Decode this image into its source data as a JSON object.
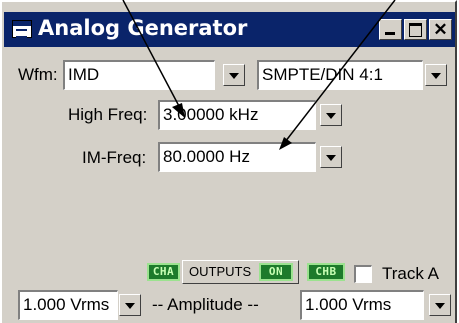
{
  "window": {
    "title": "Analog Generator"
  },
  "waveform": {
    "label": "Wfm:",
    "type_value": "IMD",
    "mode_value": "SMPTE/DIN 4:1"
  },
  "high_freq": {
    "label": "High Freq:",
    "value": "3.00000 kHz"
  },
  "im_freq": {
    "label": "IM-Freq:",
    "value": "80.0000  Hz"
  },
  "outputs": {
    "cha_badge": "CHA",
    "chb_badge": "CHB",
    "outputs_label": "OUTPUTS",
    "on_badge": "ON",
    "track_label": "Track A"
  },
  "amplitude": {
    "label": "-- Amplitude --",
    "left_value": "1.000   Vrms",
    "right_value": "1.000   Vrms"
  },
  "colors": {
    "titlebar": "#0a246a",
    "panel": "#d4d0c8",
    "badge": "#1d7a2b"
  },
  "icons": [
    "window-icon",
    "minimize-icon",
    "maximize-icon",
    "close-icon",
    "dropdown-arrow-icon",
    "annotation-arrow-icon"
  ]
}
